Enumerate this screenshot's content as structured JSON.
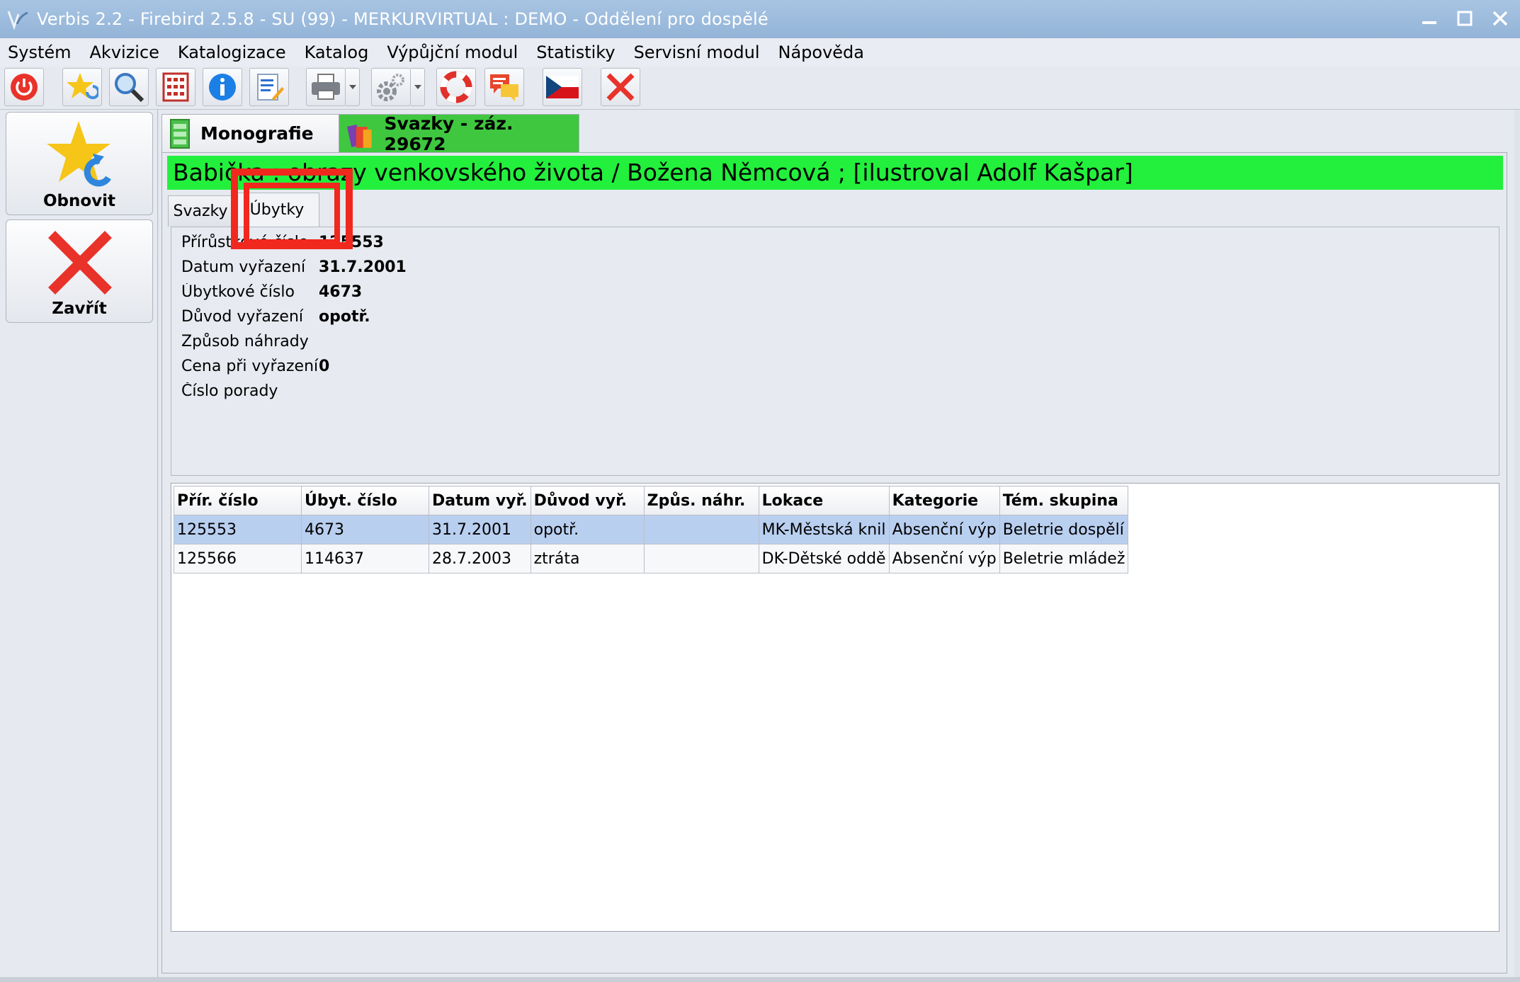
{
  "window": {
    "title": "Verbis 2.2 - Firebird 2.5.8 - SU (99) - MERKURVIRTUAL : DEMO - Oddělení pro dospělé"
  },
  "menu": [
    "Systém",
    "Akvizice",
    "Katalogizace",
    "Katalog",
    "Výpůjční modul",
    "Statistiky",
    "Servisní modul",
    "Nápověda"
  ],
  "toolbar": {
    "icons": [
      "power-icon",
      "favorite-refresh-icon",
      "search-icon",
      "calculator-icon",
      "info-icon",
      "edit-document-icon",
      "printer-icon",
      "settings-icon",
      "help-lifebuoy-icon",
      "messages-icon",
      "czech-flag-icon",
      "close-icon"
    ]
  },
  "left_panel": {
    "refresh_label": "Obnovit",
    "close_label": "Zavřít"
  },
  "doc_tabs": {
    "monografie": "Monografie",
    "svazky": "Svazky - záz. 29672"
  },
  "banner": "Babička : obrazy venkovského života / Božena Němcová ; [ilustroval Adolf Kašpar]",
  "sub_tabs": {
    "svazky": "Svazky",
    "ubytky": "Úbytky"
  },
  "details": [
    {
      "label": "Přírůstkové číslo",
      "value": "125553"
    },
    {
      "label": "Datum vyřazení",
      "value": "31.7.2001"
    },
    {
      "label": "Úbytkové číslo",
      "value": "4673"
    },
    {
      "label": "Důvod vyřazení",
      "value": "opotř."
    },
    {
      "label": "Způsob náhrady",
      "value": ""
    },
    {
      "label": "Cena při vyřazení",
      "value": "0"
    },
    {
      "label": "Číslo porady",
      "value": ""
    }
  ],
  "grid": {
    "columns": [
      "Přír. číslo",
      "Úbyt. číslo",
      "Datum vyř.",
      "Důvod vyř.",
      "Způs. náhr.",
      "Lokace",
      "Kategorie",
      "Tém. skupina"
    ],
    "rows": [
      [
        "125553",
        "4673",
        "31.7.2001",
        "opotř.",
        "",
        "MK-Městská knil",
        "Absenční výp",
        "Beletrie dospělí"
      ],
      [
        "125566",
        "114637",
        "28.7.2003",
        "ztráta",
        "",
        "DK-Dětské oddě",
        "Absenční výp",
        "Beletrie mládež"
      ]
    ],
    "selected_row": 0
  },
  "colors": {
    "banner": "#22f03c",
    "active_tab": "#3fc83f",
    "highlight": "#f0281e",
    "selected_row": "#b9cff0"
  }
}
